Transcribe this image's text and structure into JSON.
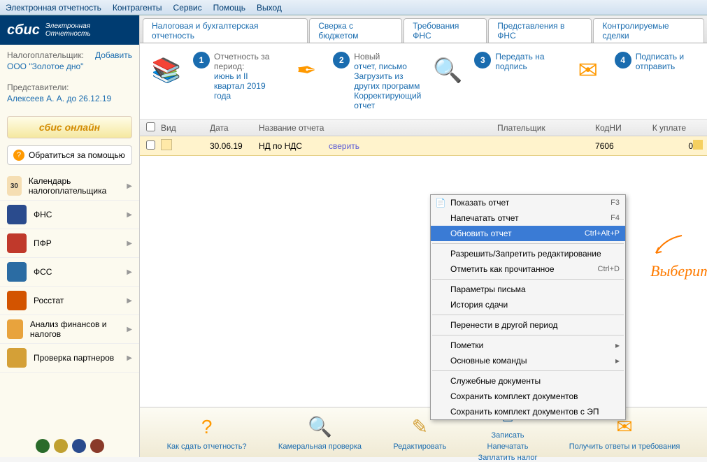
{
  "menubar": [
    "Электронная отчетность",
    "Контрагенты",
    "Сервис",
    "Помощь",
    "Выход"
  ],
  "logo": {
    "brand": "сбис",
    "sub1": "Электронная",
    "sub2": "Отчетность"
  },
  "org": {
    "label": "Налогоплательщик:",
    "add": "Добавить",
    "name": "ООО \"Золотое дно\""
  },
  "rep": {
    "label": "Представители:",
    "name": "Алексеев А. А. до 26.12.19"
  },
  "sbis_online": "сбис онлайн",
  "help_button": "Обратиться за помощью",
  "nav": [
    {
      "label": "Календарь налогоплательщика",
      "icon_bg": "#f5deb3",
      "icon_text": "30"
    },
    {
      "label": "ФНС",
      "icon_bg": "#2a4b8d",
      "icon_text": ""
    },
    {
      "label": "ПФР",
      "icon_bg": "#c0392b",
      "icon_text": ""
    },
    {
      "label": "ФСС",
      "icon_bg": "#2b6ca3",
      "icon_text": ""
    },
    {
      "label": "Росстат",
      "icon_bg": "#d35400",
      "icon_text": ""
    },
    {
      "label": "Анализ финансов и налогов",
      "icon_bg": "#e8a33d",
      "icon_text": ""
    },
    {
      "label": "Проверка партнеров",
      "icon_bg": "#d4a037",
      "icon_text": ""
    }
  ],
  "tabs": [
    "Налоговая и бухгалтерская отчетность",
    "Сверка с бюджетом",
    "Требования ФНС",
    "Представления в ФНС",
    "Контролируемые сделки"
  ],
  "steps": [
    {
      "num": "1",
      "label": "Отчетность за период:",
      "links": [
        "июнь и II квартал 2019 года"
      ]
    },
    {
      "num": "2",
      "label": "Новый",
      "links": [
        "отчет, письмо",
        "Загрузить из других программ",
        "Корректирующий отчет"
      ]
    },
    {
      "num": "3",
      "label": "",
      "links": [
        "Передать на подпись"
      ]
    },
    {
      "num": "4",
      "label": "",
      "links": [
        "Подписать и отправить"
      ]
    }
  ],
  "grid": {
    "headers": {
      "vid": "Вид",
      "date": "Дата",
      "name": "Название отчета",
      "payer": "Плательщик",
      "code": "КодНИ",
      "pay": "К уплате"
    },
    "row": {
      "date": "30.06.19",
      "name": "НД по НДС",
      "verify": "сверить",
      "code": "7606",
      "pay": "0"
    }
  },
  "context_menu": [
    {
      "type": "item",
      "label": "Показать отчет",
      "shortcut": "F3",
      "icon": "📄"
    },
    {
      "type": "item",
      "label": "Напечатать отчет",
      "shortcut": "F4"
    },
    {
      "type": "item",
      "label": "Обновить отчет",
      "shortcut": "Ctrl+Alt+P",
      "highlighted": true
    },
    {
      "type": "sep"
    },
    {
      "type": "item",
      "label": "Разрешить/Запретить редактирование"
    },
    {
      "type": "item",
      "label": "Отметить как прочитанное",
      "shortcut": "Ctrl+D"
    },
    {
      "type": "sep"
    },
    {
      "type": "item",
      "label": "Параметры письма"
    },
    {
      "type": "item",
      "label": "История сдачи"
    },
    {
      "type": "sep"
    },
    {
      "type": "item",
      "label": "Перенести в другой период"
    },
    {
      "type": "sep"
    },
    {
      "type": "item",
      "label": "Пометки",
      "submenu": true
    },
    {
      "type": "item",
      "label": "Основные команды",
      "submenu": true
    },
    {
      "type": "sep"
    },
    {
      "type": "item",
      "label": "Служебные документы"
    },
    {
      "type": "item",
      "label": "Сохранить комплект документов"
    },
    {
      "type": "item",
      "label": "Сохранить комплект документов с ЭП"
    }
  ],
  "annotation": "Выберите",
  "bottom_bar": [
    {
      "label": "Как сдать отчетность?",
      "icon": "?"
    },
    {
      "label": "Камеральная проверка",
      "icon": "🔍"
    },
    {
      "label": "Редактировать",
      "icon": "✎"
    },
    {
      "label_lines": [
        "Записать",
        "Напечатать",
        "Заплатить налог"
      ],
      "icon": "🖶"
    },
    {
      "label": "Получить ответы и требования",
      "icon": "✉"
    }
  ]
}
